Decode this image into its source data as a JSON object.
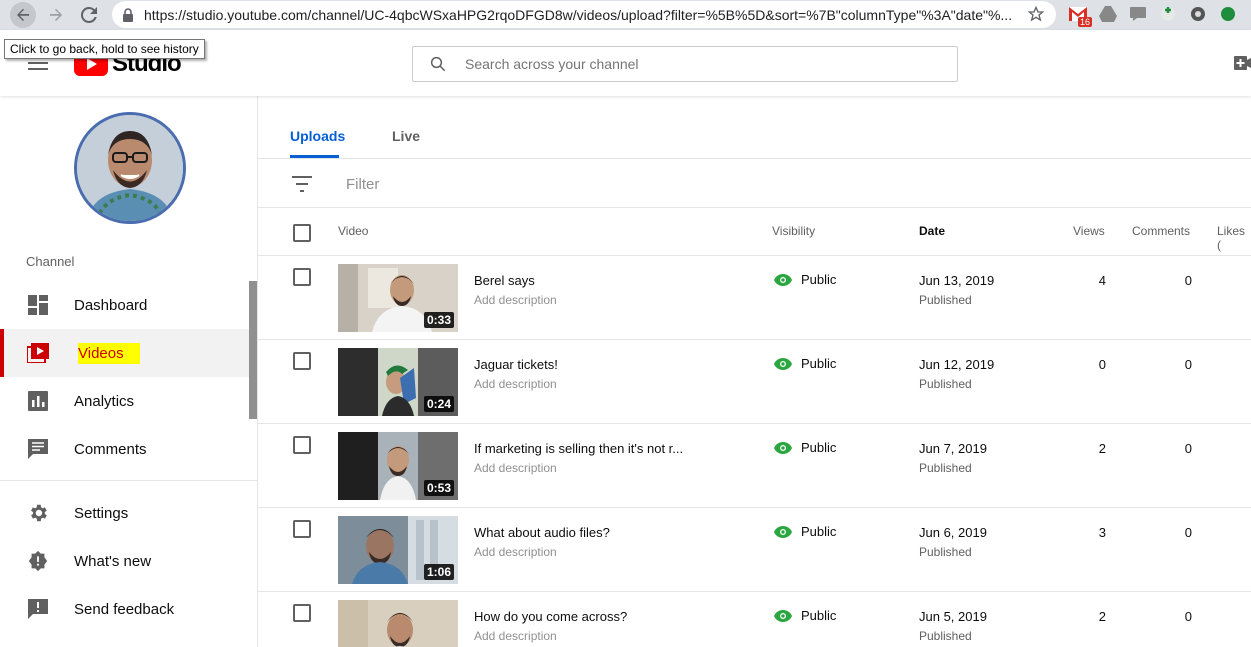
{
  "browser": {
    "url": "https://studio.youtube.com/channel/UC-4qbcWSxaHPG2rqoDFGD8w/videos/upload?filter=%5B%5D&sort=%7B\"columnType\"%3A\"date\"%...",
    "tooltip": "Click to go back, hold to see history",
    "gmail_badge": "16",
    "extensions": [
      "gmail-icon",
      "drive-icon",
      "chat-icon",
      "tasks-icon",
      "record-icon",
      "profile-icon"
    ]
  },
  "header": {
    "logo_text": "Studio",
    "search_placeholder": "Search across your channel"
  },
  "sidebar": {
    "section_label": "Channel",
    "items": [
      {
        "label": "Dashboard",
        "icon": "dashboard-icon"
      },
      {
        "label": "Videos",
        "icon": "videos-icon",
        "active": true
      },
      {
        "label": "Analytics",
        "icon": "analytics-icon"
      },
      {
        "label": "Comments",
        "icon": "comments-icon"
      },
      {
        "label": "Settings",
        "icon": "settings-icon"
      },
      {
        "label": "What's new",
        "icon": "whats-new-icon"
      },
      {
        "label": "Send feedback",
        "icon": "feedback-icon"
      }
    ]
  },
  "main": {
    "tabs": [
      "Uploads",
      "Live"
    ],
    "filter_placeholder": "Filter",
    "columns": {
      "video": "Video",
      "visibility": "Visibility",
      "date": "Date",
      "views": "Views",
      "comments": "Comments",
      "likes": "Likes ("
    },
    "rows": [
      {
        "title": "Berel says",
        "description": "Add description",
        "duration": "0:33",
        "visibility": "Public",
        "date": "Jun 13, 2019",
        "status": "Published",
        "views": "4",
        "comments": "0"
      },
      {
        "title": "Jaguar tickets!",
        "description": "Add description",
        "duration": "0:24",
        "visibility": "Public",
        "date": "Jun 12, 2019",
        "status": "Published",
        "views": "0",
        "comments": "0"
      },
      {
        "title": "If marketing is selling then it's not r...",
        "description": "Add description",
        "duration": "0:53",
        "visibility": "Public",
        "date": "Jun 7, 2019",
        "status": "Published",
        "views": "2",
        "comments": "0"
      },
      {
        "title": "What about audio files?",
        "description": "Add description",
        "duration": "1:06",
        "visibility": "Public",
        "date": "Jun 6, 2019",
        "status": "Published",
        "views": "3",
        "comments": "0"
      },
      {
        "title": "How do you come across?",
        "description": "Add description",
        "duration": "",
        "visibility": "Public",
        "date": "Jun 5, 2019",
        "status": "Published",
        "views": "2",
        "comments": "0"
      }
    ]
  },
  "colors": {
    "accent_blue": "#065fd4",
    "active_red": "#cc0000",
    "public_green": "#2ba640",
    "highlight_yellow": "#ffff00"
  }
}
